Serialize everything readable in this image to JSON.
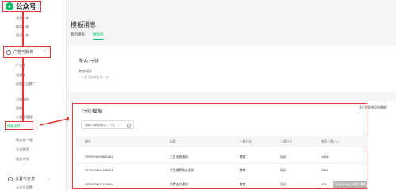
{
  "app": {
    "title": "公众号"
  },
  "sidebar": {
    "top_items": [
      "消息分析",
      "接口分析",
      "网页分析"
    ],
    "group_ads": "广告与服务",
    "ad_items": [
      "广告主",
      "流量主",
      "返佣商品推广"
    ],
    "service_items": [
      "订阅通知",
      "客服",
      "小程序管理",
      "模板消息",
      "微信搜一搜",
      "企业微信",
      "服务市场"
    ],
    "active_item": "模板消息",
    "group_dev": "设置与开发",
    "dev_item": "公众号设置"
  },
  "main": {
    "title": "模板消息",
    "tabs": [
      "我的模板",
      "模板库"
    ],
    "active_tab": "模板库",
    "industry": {
      "heading": "所在行业",
      "value": "教育/培训",
      "note": "一个月可修改行业一次"
    },
    "library": {
      "heading": "行业模板",
      "link": "找不到你想要的模板？",
      "search_placeholder": "请输入模板编号、行业",
      "columns": [
        "编号",
        "标题",
        "一级行业",
        "二级行业",
        "使用人数(人)"
      ],
      "rows": [
        [
          "OPENTM200851601",
          "工资发放通知",
          "教育",
          "培训",
          "1018"
        ],
        [
          "OPENTM201205001",
          "学生缴费确认通知",
          "教育",
          "培训",
          "3551"
        ],
        [
          "OPENTM211131804",
          "学费支付通知",
          "教育",
          "培训",
          "625"
        ]
      ]
    }
  },
  "watermark": "头条号/@QQ微信课程",
  "colors": {
    "accent": "#07c160",
    "annotation": "#e53935"
  }
}
